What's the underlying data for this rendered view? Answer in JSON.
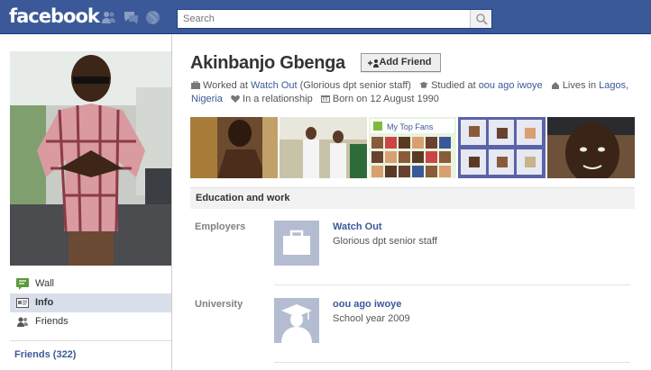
{
  "topbar": {
    "logo": "facebook",
    "search": {
      "placeholder": "Search"
    }
  },
  "profile": {
    "name": "Akinbanjo Gbenga",
    "add_friend_label": "Add Friend",
    "work_prefix": "Worked at ",
    "work_place": "Watch Out",
    "work_role": " (Glorious dpt senior staff)",
    "study_prefix": "Studied at ",
    "study_place": "oou ago iwoye",
    "lives_prefix": "Lives in ",
    "lives_city": "Lagos,",
    "lives_country": "Nigeria",
    "relationship": "In a relationship",
    "birthday": "Born on 12 August 1990"
  },
  "photos": {
    "fans_label": "My Top Fans"
  },
  "sidebar": {
    "items": [
      {
        "label": "Wall",
        "icon": "wall-icon"
      },
      {
        "label": "Info",
        "icon": "info-icon"
      },
      {
        "label": "Friends",
        "icon": "friends-icon"
      }
    ],
    "friends_count_label": "Friends (322)"
  },
  "education_work": {
    "heading": "Education and work",
    "employers_label": "Employers",
    "employer": {
      "name": "Watch Out",
      "detail": "Glorious dpt senior staff"
    },
    "university_label": "University",
    "university": {
      "name": "oou ago iwoye",
      "detail": "School year 2009"
    }
  },
  "colors": {
    "brand": "#3b5998",
    "sidebar_active": "#d8dfea",
    "placeholder_thumb": "#b4bcd1"
  }
}
